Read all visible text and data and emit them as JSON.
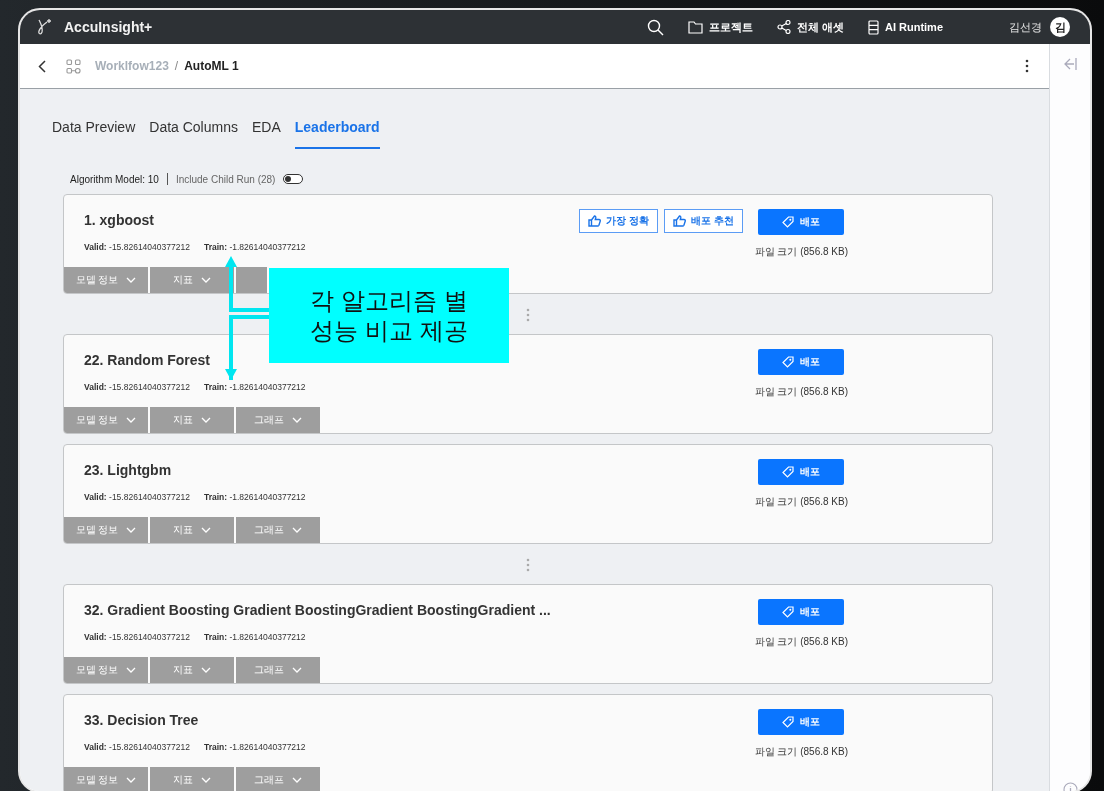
{
  "app": {
    "name": "AccuInsight+"
  },
  "top_nav": [
    {
      "kind": "folder",
      "label": "프로젝트"
    },
    {
      "kind": "share",
      "label": "전체 애셋"
    },
    {
      "kind": "server",
      "label": "AI Runtime"
    }
  ],
  "user": {
    "name": "김선경",
    "initial": "김"
  },
  "breadcrumb": {
    "separator": "/",
    "items": [
      {
        "label": "Worklfow123",
        "current": false
      },
      {
        "label": "AutoML 1",
        "current": true
      }
    ]
  },
  "tabs": [
    {
      "label": "Data Preview",
      "selected": false
    },
    {
      "label": "Data Columns",
      "selected": false
    },
    {
      "label": "EDA",
      "selected": false
    },
    {
      "label": "Leaderboard",
      "selected": true
    }
  ],
  "filter": {
    "algorithm_count": "Algorithm Model: 10",
    "child_run_label": "Include Child Run (28)",
    "include_child_run": false
  },
  "models": [
    {
      "title": "1. xgboost",
      "valid_label": "Valid:",
      "valid_value": "-15.82614040377212",
      "train_label": "Train:",
      "train_value": "-1.82614040377212",
      "badges": [
        "가장 정확",
        "배포 추천"
      ],
      "deploy_label": "배포",
      "file_size": "파일 크기 (856.8 KB)",
      "sections": [
        "모델 정보",
        "지표"
      ],
      "covered_section": true,
      "gap_after": true
    },
    {
      "title": "22. Random Forest",
      "valid_label": "Valid:",
      "valid_value": "-15.82614040377212",
      "train_label": "Train:",
      "train_value": "-1.82614040377212",
      "deploy_label": "배포",
      "file_size": "파일 크기 (856.8 KB)",
      "sections": [
        "모델 정보",
        "지표",
        "그래프"
      ],
      "gap_after": false
    },
    {
      "title": "23. Lightgbm",
      "valid_label": "Valid:",
      "valid_value": "-15.82614040377212",
      "train_label": "Train:",
      "train_value": "-1.82614040377212",
      "deploy_label": "배포",
      "file_size": "파일 크기 (856.8 KB)",
      "sections": [
        "모델 정보",
        "지표",
        "그래프"
      ],
      "gap_after": true
    },
    {
      "title": "32. Gradient Boosting Gradient BoostingGradient BoostingGradient ...",
      "valid_label": "Valid:",
      "valid_value": "-15.82614040377212",
      "train_label": "Train:",
      "train_value": "-1.82614040377212",
      "deploy_label": "배포",
      "file_size": "파일 크기 (856.8 KB)",
      "sections": [
        "모델 정보",
        "지표",
        "그래프"
      ],
      "gap_after": false
    },
    {
      "title": "33. Decision Tree",
      "valid_label": "Valid:",
      "valid_value": "-15.82614040377212",
      "train_label": "Train:",
      "train_value": "-1.82614040377212",
      "deploy_label": "배포",
      "file_size": "파일 크기 (856.8 KB)",
      "sections": [
        "모델 정보",
        "지표",
        "그래프"
      ],
      "gap_after": false
    }
  ],
  "callout": {
    "text": "각 알고리즘 별\n성능 비교 제공"
  }
}
